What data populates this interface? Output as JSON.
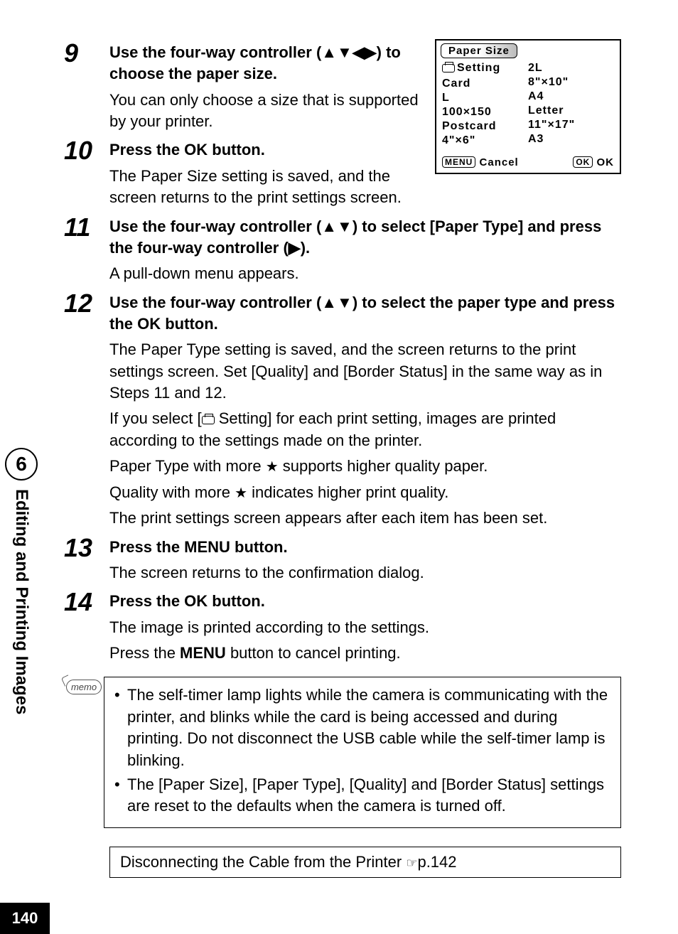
{
  "sideTab": {
    "number": "6",
    "title": "Editing and Printing Images"
  },
  "pageNumber": "140",
  "screen": {
    "title": "Paper Size",
    "leftCol": [
      "Setting",
      "Card",
      "L",
      "100×150",
      "Postcard",
      "4\"×6\""
    ],
    "rightCol": [
      "2L",
      "8\"×10\"",
      "A4",
      "Letter",
      "11\"×17\"",
      "A3"
    ],
    "footLeftBtn": "MENU",
    "footLeftLabel": "Cancel",
    "footRightBtn": "OK",
    "footRightLabel": "OK"
  },
  "steps": {
    "s9": {
      "num": "9",
      "head1": "Use the four-way controller ",
      "head2": "(",
      "arrows": "▲▼◀▶",
      "head3": ") to choose the paper size.",
      "desc": "You can only choose a size that is supported by your printer."
    },
    "s10": {
      "num": "10",
      "head1": "Press the ",
      "ok": "OK",
      "head2": " button.",
      "desc": "The Paper Size setting is saved, and the screen returns to the print settings screen."
    },
    "s11": {
      "num": "11",
      "part1": "Use the four-way controller (",
      "arrows1": "▲▼",
      "part2": ") to select [Paper Type] and press the four-way controller (",
      "arrows2": "▶",
      "part3": ").",
      "desc": "A pull-down menu appears."
    },
    "s12": {
      "num": "12",
      "part1": "Use the four-way controller (",
      "arrows": "▲▼",
      "part2": ") to select the paper type and press the ",
      "ok": "OK",
      "part3": " button.",
      "desc1": "The Paper Type setting is saved, and the screen returns to the print settings screen. Set [Quality] and [Border Status] in the same way as in Steps 11 and 12.",
      "desc2a": "If you select [",
      "desc2b": " Setting] for each print setting, images are printed according to the settings made on the printer.",
      "desc3a": "Paper Type with more ",
      "desc3b": " supports higher quality paper.",
      "desc4a": "Quality with more ",
      "desc4b": " indicates higher print quality.",
      "desc5": "The print settings screen appears after each item has been set."
    },
    "s13": {
      "num": "13",
      "head": "Press the MENU button.",
      "desc": "The screen returns to the confirmation dialog."
    },
    "s14": {
      "num": "14",
      "head1": "Press the ",
      "ok": "OK",
      "head2": " button.",
      "desc1": "The image is printed according to the settings.",
      "desc2a": "Press the ",
      "desc2b": "MENU",
      "desc2c": " button to cancel printing."
    }
  },
  "memo": {
    "label": "memo",
    "item1": "The self-timer lamp lights while the camera is communicating with the printer, and blinks while the card is being accessed and during printing. Do not disconnect the USB cable while the self-timer lamp is blinking.",
    "item2": "The [Paper Size], [Paper Type], [Quality] and [Border Status] settings are reset to the defaults when the camera is turned off."
  },
  "ref": {
    "text": "Disconnecting the Cable from the Printer ",
    "page": "p.142"
  }
}
